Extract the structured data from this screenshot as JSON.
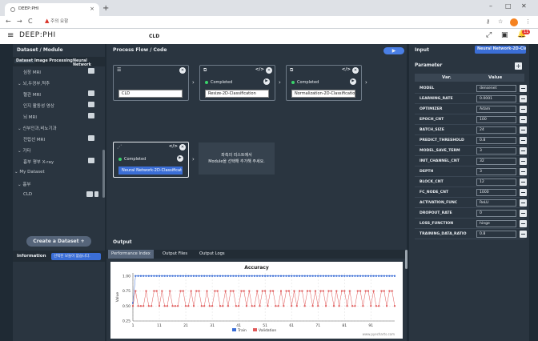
{
  "browser": {
    "tab_title": "DEEP:PHI",
    "address_warning": "주의 요함",
    "address_text": ""
  },
  "app": {
    "brand": "DEEP:PHI",
    "project_name": "CLD",
    "notification_count": "11"
  },
  "left": {
    "title": "Dataset / Module",
    "tabs": [
      "Dataset",
      "Image Processing",
      "Neural Network"
    ],
    "tree": [
      {
        "label": "심장 MRI",
        "icon": true
      },
      {
        "label": "뇌,두경부,척추",
        "arrow": true
      },
      {
        "label": "혈관 MRI",
        "icon": true
      },
      {
        "label": "인지 활동성 영상",
        "icon": true
      },
      {
        "label": "뇌 MRI",
        "icon": true
      },
      {
        "label": "신부인과,비뇨기과",
        "arrow": true
      },
      {
        "label": "전립선 MRI",
        "icon": true
      },
      {
        "label": "기타",
        "arrow": true
      },
      {
        "label": "흉부 평부 X-ray",
        "icon": true
      },
      {
        "label": "My Dataset",
        "arrow": true
      },
      {
        "label": "흉부",
        "arrow": true
      },
      {
        "label": "CLD",
        "icon": true,
        "trash": true
      }
    ],
    "create_button": "Create a Dataset",
    "info_label": "Information",
    "info_select": "선택된 보들이 없습니다."
  },
  "flow": {
    "title": "Process Flow / Code",
    "nodes": [
      {
        "id": "n1",
        "status": "",
        "name": "CLD"
      },
      {
        "id": "n2",
        "status": "Completed",
        "name": "Resize-2D-Classification"
      },
      {
        "id": "n3",
        "status": "Completed",
        "name": "Normalization-2D-Classification"
      },
      {
        "id": "n4",
        "status": "Completed",
        "name": "Neural Network-2D-Classification"
      }
    ],
    "hint_line1": "좌측의 리스트에서",
    "hint_line2": "Module을 선택해 추가해 주세요."
  },
  "output": {
    "title": "Output",
    "tabs": [
      "Performance Index",
      "Output Files",
      "Output Logs"
    ]
  },
  "right": {
    "title": "Input",
    "input_select": "Neural Network-2D-Classification",
    "param_title": "Parameter",
    "col_var": "Var.",
    "col_value": "Value",
    "params": [
      {
        "k": "MODEL",
        "v": "densenet"
      },
      {
        "k": "LEARNING_RATE",
        "v": "0.0001"
      },
      {
        "k": "OPTIMIZER",
        "v": "Adam"
      },
      {
        "k": "EPOCH_CNT",
        "v": "100"
      },
      {
        "k": "BATCH_SIZE",
        "v": "24"
      },
      {
        "k": "PREDICT_THRESHOLD",
        "v": "0.8"
      },
      {
        "k": "MODEL_SAVE_TERM",
        "v": "3"
      },
      {
        "k": "INIT_CHANNEL_CNT",
        "v": "32"
      },
      {
        "k": "DEPTH",
        "v": "3"
      },
      {
        "k": "BLOCK_CNT",
        "v": "12"
      },
      {
        "k": "FC_NODE_CNT",
        "v": "1000"
      },
      {
        "k": "ACTIVATION_FUNC",
        "v": "ReLU"
      },
      {
        "k": "DROPOUT_RATE",
        "v": "0"
      },
      {
        "k": "LOSS_FUNCTION",
        "v": "hinge"
      },
      {
        "k": "TRAINING_DATA_RATIO",
        "v": "0.8"
      }
    ]
  },
  "chart_data": {
    "type": "line",
    "title": "Accuracy",
    "xlabel": "",
    "ylabel": "Value",
    "x_ticks": [
      "1",
      "11",
      "21",
      "31",
      "41",
      "51",
      "61",
      "71",
      "81",
      "91"
    ],
    "y_ticks": [
      "0.25",
      "0.50",
      "0.75",
      "1.00"
    ],
    "ylim": [
      0.25,
      1.05
    ],
    "xlim": [
      1,
      100
    ],
    "grid": true,
    "legend": "bottom",
    "credit": "www.pyecharts.com",
    "series": [
      {
        "name": "Train",
        "color": "#3b6ed6",
        "style": "line-markers",
        "values": [
          0.55,
          1.0,
          1.0,
          1.0,
          1.0,
          1.0,
          1.0,
          1.0,
          1.0,
          1.0,
          1.0,
          1.0,
          1.0,
          1.0,
          1.0,
          1.0,
          1.0,
          1.0,
          1.0,
          1.0,
          1.0,
          1.0,
          1.0,
          1.0,
          1.0,
          1.0,
          1.0,
          1.0,
          1.0,
          1.0,
          1.0,
          1.0,
          1.0,
          1.0,
          1.0,
          1.0,
          1.0,
          1.0,
          1.0,
          1.0,
          1.0,
          1.0,
          1.0,
          1.0,
          1.0,
          1.0,
          1.0,
          1.0,
          1.0,
          1.0,
          1.0,
          1.0,
          1.0,
          1.0,
          1.0,
          1.0,
          1.0,
          1.0,
          1.0,
          1.0,
          1.0,
          1.0,
          1.0,
          1.0,
          1.0,
          1.0,
          1.0,
          1.0,
          1.0,
          1.0,
          1.0,
          1.0,
          1.0,
          1.0,
          1.0,
          1.0,
          1.0,
          1.0,
          1.0,
          1.0,
          1.0,
          1.0,
          1.0,
          1.0,
          1.0,
          1.0,
          1.0,
          1.0,
          1.0,
          1.0,
          1.0,
          1.0,
          1.0,
          1.0,
          1.0,
          1.0,
          1.0,
          1.0,
          1.0,
          1.0
        ]
      },
      {
        "name": "Validation",
        "color": "#e05a5a",
        "style": "line-markers",
        "values": [
          0.5,
          0.75,
          0.5,
          0.5,
          0.5,
          0.75,
          0.5,
          0.5,
          0.75,
          0.75,
          0.5,
          0.75,
          0.5,
          0.5,
          0.75,
          0.5,
          0.5,
          0.5,
          0.75,
          0.75,
          0.5,
          0.5,
          0.75,
          0.5,
          0.75,
          0.75,
          0.5,
          0.5,
          0.75,
          0.5,
          0.5,
          0.75,
          0.75,
          0.5,
          0.5,
          0.75,
          0.5,
          0.75,
          0.75,
          0.5,
          0.5,
          0.75,
          0.75,
          0.5,
          0.75,
          0.5,
          0.5,
          0.75,
          0.5,
          0.75,
          0.75,
          0.5,
          0.75,
          0.75,
          0.5,
          0.5,
          0.75,
          0.5,
          0.75,
          0.75,
          0.5,
          0.75,
          0.5,
          0.75,
          0.75,
          0.5,
          0.75,
          0.75,
          0.5,
          0.75,
          0.5,
          0.75,
          0.75,
          0.5,
          0.75,
          0.75,
          0.5,
          0.75,
          0.5,
          0.75,
          0.75,
          0.5,
          0.75,
          0.5,
          0.5,
          0.75,
          0.75,
          0.5,
          0.75,
          0.75,
          0.5,
          0.75,
          0.5,
          0.5,
          0.75,
          0.75,
          0.5,
          0.75,
          0.75,
          0.5
        ]
      }
    ]
  }
}
